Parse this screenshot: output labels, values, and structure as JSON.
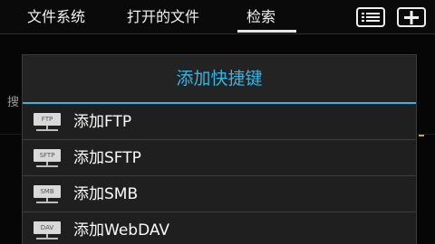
{
  "tabs": [
    {
      "label": "文件系统"
    },
    {
      "label": "打开的文件"
    },
    {
      "label": "检索"
    }
  ],
  "toolbar": {
    "menu_icon": "list-menu-icon",
    "add_icon": "add-icon"
  },
  "background": {
    "search_label": "搜"
  },
  "dialog": {
    "title": "添加快捷键",
    "items": [
      {
        "label": "添加FTP",
        "icon_text": "FTP"
      },
      {
        "label": "添加SFTP",
        "icon_text": "SFTP"
      },
      {
        "label": "添加SMB",
        "icon_text": "SMB"
      },
      {
        "label": "添加WebDAV",
        "icon_text": "DAV"
      }
    ]
  },
  "colors": {
    "accent": "#33b5e5",
    "dialog_bg": "#232323"
  }
}
